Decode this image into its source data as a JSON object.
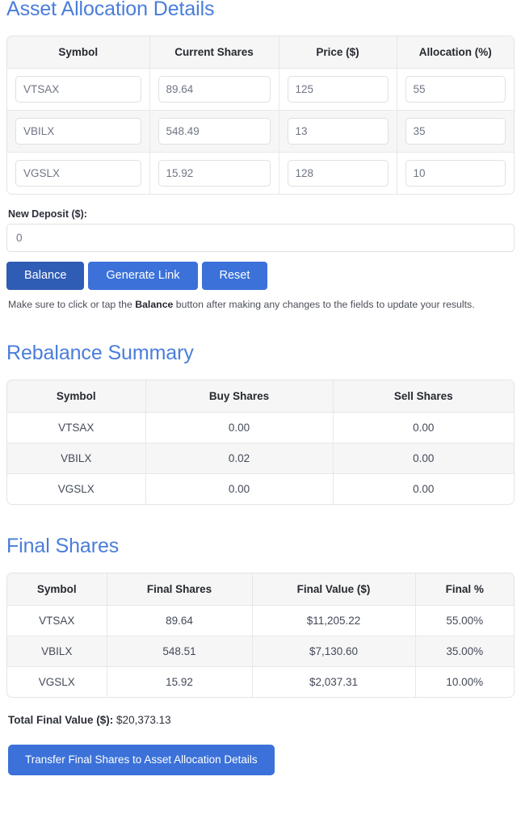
{
  "theme": {
    "heading_color": "#4a7ddb",
    "button_primary": "#3b71d9",
    "button_primary_dark": "#2f5cb4",
    "header_row_bg": "#f6f6f7",
    "stripe_bg": "#f6f6f7",
    "border_color": "#e4e4e7"
  },
  "allocation": {
    "title": "Asset Allocation Details",
    "columns": [
      "Symbol",
      "Current Shares",
      "Price ($)",
      "Allocation (%)"
    ],
    "rows": [
      {
        "symbol": "VTSAX",
        "current_shares": "89.64",
        "price": "125",
        "allocation": "55"
      },
      {
        "symbol": "VBILX",
        "current_shares": "548.49",
        "price": "13",
        "allocation": "35"
      },
      {
        "symbol": "VGSLX",
        "current_shares": "15.92",
        "price": "128",
        "allocation": "10"
      }
    ]
  },
  "deposit": {
    "label": "New Deposit ($):",
    "value": "0"
  },
  "actions": {
    "balance_label": "Balance",
    "generate_link_label": "Generate Link",
    "reset_label": "Reset"
  },
  "hint": {
    "before": "Make sure to click or tap the ",
    "bold": "Balance",
    "after": " button after making any changes to the fields to update your results."
  },
  "rebalance": {
    "title": "Rebalance Summary",
    "columns": [
      "Symbol",
      "Buy Shares",
      "Sell Shares"
    ],
    "rows": [
      {
        "symbol": "VTSAX",
        "buy": "0.00",
        "sell": "0.00"
      },
      {
        "symbol": "VBILX",
        "buy": "0.02",
        "sell": "0.00"
      },
      {
        "symbol": "VGSLX",
        "buy": "0.00",
        "sell": "0.00"
      }
    ]
  },
  "final": {
    "title": "Final Shares",
    "columns": [
      "Symbol",
      "Final Shares",
      "Final Value ($)",
      "Final %"
    ],
    "rows": [
      {
        "symbol": "VTSAX",
        "shares": "89.64",
        "value": "$11,205.22",
        "pct": "55.00%"
      },
      {
        "symbol": "VBILX",
        "shares": "548.51",
        "value": "$7,130.60",
        "pct": "35.00%"
      },
      {
        "symbol": "VGSLX",
        "shares": "15.92",
        "value": "$2,037.31",
        "pct": "10.00%"
      }
    ],
    "total_label": "Total Final Value ($):",
    "total_value": "$20,373.13",
    "transfer_label": "Transfer Final Shares to Asset Allocation Details"
  }
}
